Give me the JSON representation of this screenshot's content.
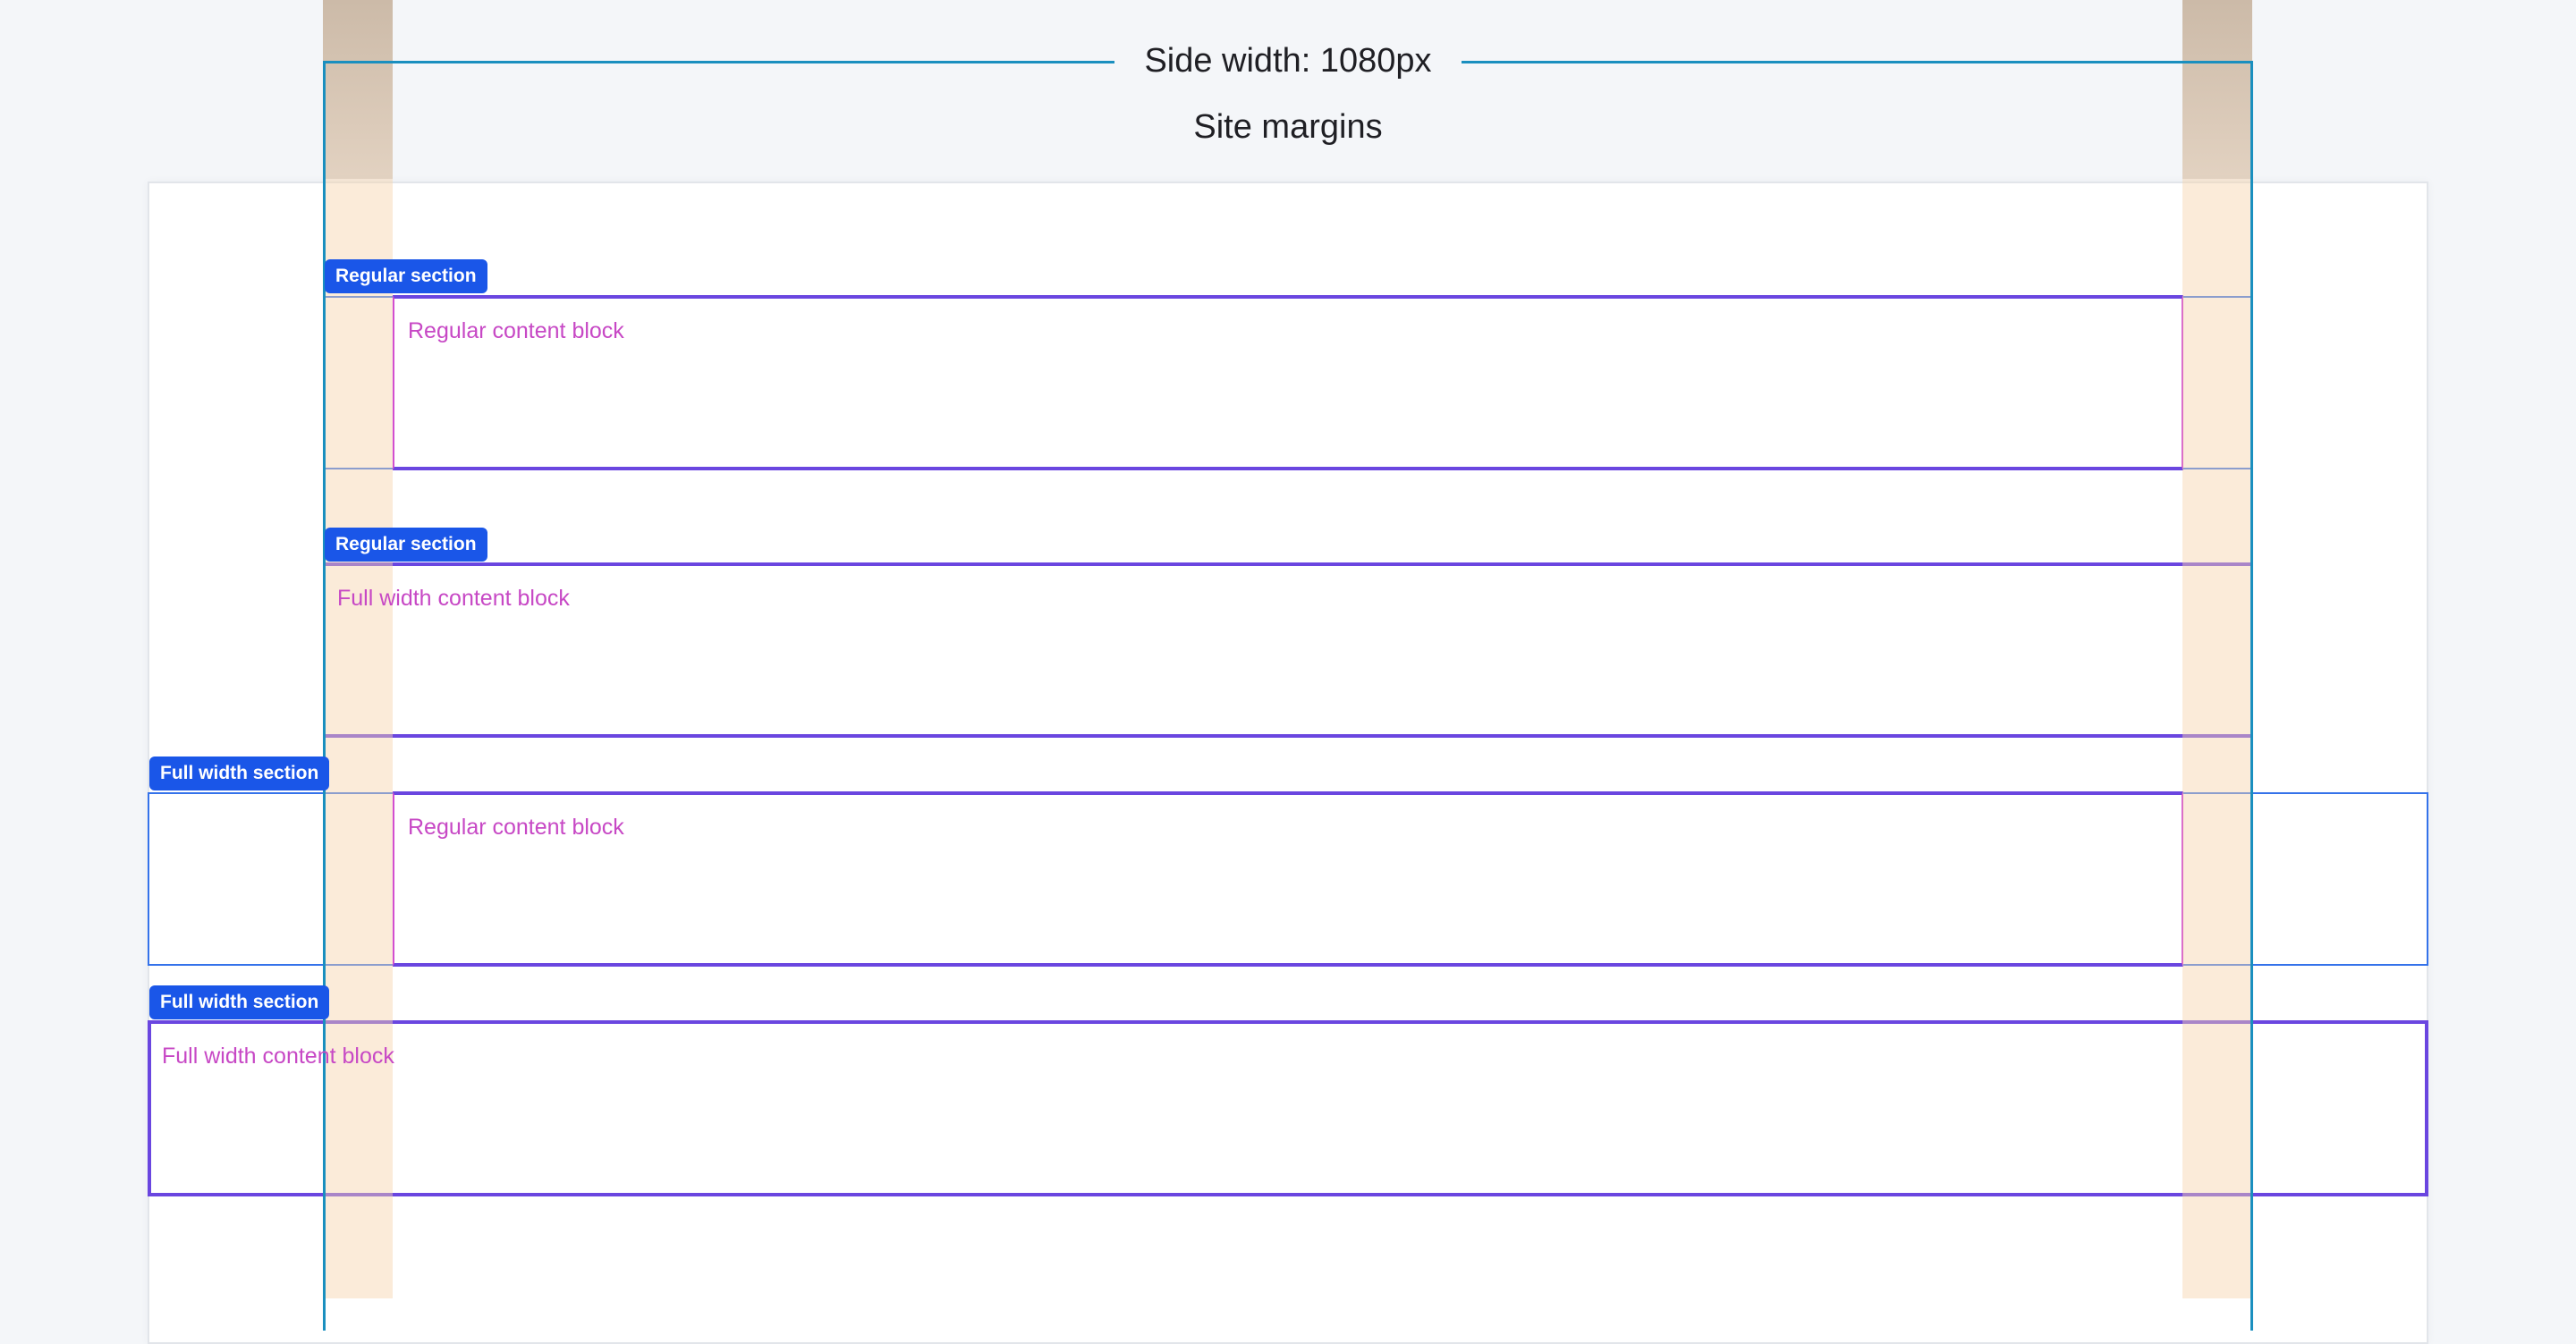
{
  "header": {
    "site_width_title": "Side width: 1080px",
    "site_margins_label": "Site margins"
  },
  "sections": [
    {
      "tag": "Regular section",
      "content_label": "Regular content block"
    },
    {
      "tag": "Regular section",
      "content_label": "Full width content block"
    },
    {
      "tag": "Full width section",
      "content_label": "Regular content block"
    },
    {
      "tag": "Full width section",
      "content_label": "Full width content block"
    }
  ],
  "colors": {
    "background": "#f4f6f9",
    "canvas": "#ffffff",
    "margin_band": "#f7d3aa",
    "site_width_line": "#1a8fbf",
    "section_border": "#3472ea",
    "tag_background": "#1a56e8",
    "content_border": "#6a46e0",
    "content_side_border": "#d24fd0",
    "content_text": "#c748c5"
  }
}
